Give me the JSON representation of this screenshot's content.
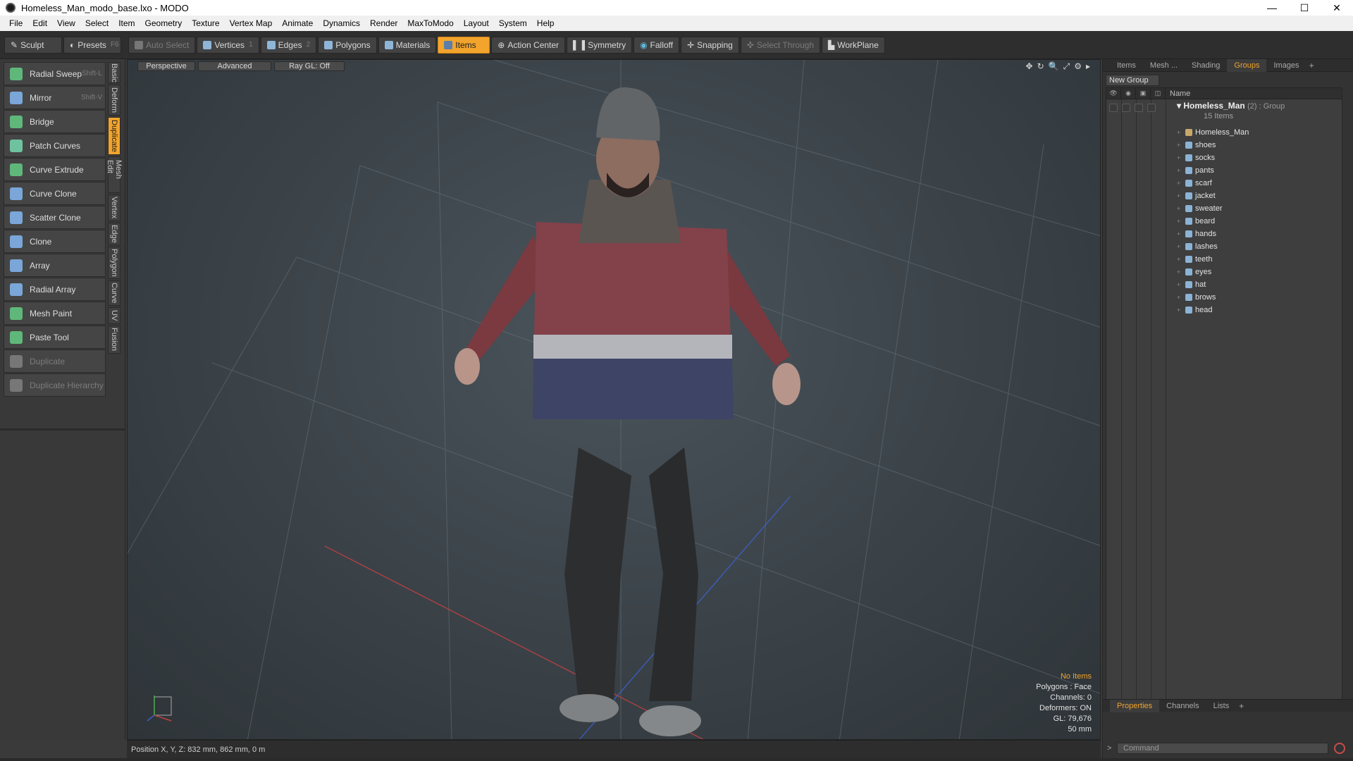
{
  "window": {
    "title": "Homeless_Man_modo_base.lxo - MODO",
    "controls": [
      "—",
      "☐",
      "✕"
    ]
  },
  "menu": [
    "File",
    "Edit",
    "View",
    "Select",
    "Item",
    "Geometry",
    "Texture",
    "Vertex Map",
    "Animate",
    "Dynamics",
    "Render",
    "MaxToModo",
    "Layout",
    "System",
    "Help"
  ],
  "toolbar": {
    "sculpt": "Sculpt",
    "presets": "Presets",
    "presets_key": "F6",
    "auto_select": "Auto Select",
    "vertices": "Vertices",
    "vertices_count": "1",
    "edges": "Edges",
    "edges_count": "2",
    "polygons": "Polygons",
    "materials": "Materials",
    "items": "Items",
    "action_center": "Action Center",
    "symmetry": "Symmetry",
    "falloff": "Falloff",
    "snapping": "Snapping",
    "select_through": "Select Through",
    "workplane": "WorkPlane"
  },
  "tools": [
    {
      "label": "Radial Sweep",
      "key": "Shift-L",
      "color": "#5fb87a"
    },
    {
      "label": "Mirror",
      "key": "Shift-V",
      "color": "#7aa6d8"
    },
    {
      "label": "Bridge",
      "key": "",
      "color": "#5fb87a"
    },
    {
      "label": "Patch Curves",
      "key": "",
      "color": "#6fc2a0"
    },
    {
      "label": "Curve Extrude",
      "key": "",
      "color": "#5fb87a"
    },
    {
      "label": "Curve Clone",
      "key": "",
      "color": "#7aa6d8"
    },
    {
      "label": "Scatter Clone",
      "key": "",
      "color": "#7aa6d8"
    },
    {
      "label": "Clone",
      "key": "",
      "color": "#7aa6d8"
    },
    {
      "label": "Array",
      "key": "",
      "color": "#7aa6d8"
    },
    {
      "label": "Radial Array",
      "key": "",
      "color": "#7aa6d8"
    },
    {
      "label": "Mesh Paint",
      "key": "",
      "color": "#5fb87a"
    },
    {
      "label": "Paste Tool",
      "key": "",
      "color": "#5fb87a"
    },
    {
      "label": "Duplicate",
      "key": "",
      "color": "#777777"
    },
    {
      "label": "Duplicate Hierarchy",
      "key": "",
      "color": "#777777"
    }
  ],
  "vtabs": [
    {
      "label": "Basic",
      "h": 30
    },
    {
      "label": "Deform",
      "h": 44
    },
    {
      "label": "Duplicate",
      "h": 54
    },
    {
      "label": "Mesh Edit",
      "h": 52
    },
    {
      "label": "Vertex",
      "h": 38
    },
    {
      "label": "Edge",
      "h": 32
    },
    {
      "label": "Polygon",
      "h": 46
    },
    {
      "label": "Curve",
      "h": 36
    },
    {
      "label": "UV",
      "h": 24
    },
    {
      "label": "Fusion",
      "h": 40
    }
  ],
  "viewport": {
    "tabs": [
      "Perspective",
      "Advanced",
      "Ray GL: Off"
    ],
    "icons": [
      "✥",
      "↻",
      "🔍",
      "⤢",
      "⚙",
      "▸"
    ],
    "info": {
      "no_items": "No Items",
      "polygons": "Polygons : Face",
      "channels": "Channels: 0",
      "deformers": "Deformers: ON",
      "gl": "GL: 79,676",
      "focal": "50 mm"
    }
  },
  "status": {
    "position": "Position X, Y, Z:  832 mm, 862 mm, 0 m"
  },
  "rightpanel": {
    "tabs": [
      "Items",
      "Mesh ...",
      "Shading",
      "Groups",
      "Images"
    ],
    "active_tab": "Groups",
    "new_group": "New Group",
    "name_header": "Name",
    "group_name": "Homeless_Man",
    "group_meta": "(2) : Group",
    "group_count": "15 Items",
    "items": [
      "Homeless_Man",
      "shoes",
      "socks",
      "pants",
      "scarf",
      "jacket",
      "sweater",
      "beard",
      "hands",
      "lashes",
      "teeth",
      "eyes",
      "hat",
      "brows",
      "head"
    ],
    "bottom_tabs": [
      "Properties",
      "Channels",
      "Lists"
    ],
    "command_placeholder": "Command",
    "prompt": ">"
  }
}
